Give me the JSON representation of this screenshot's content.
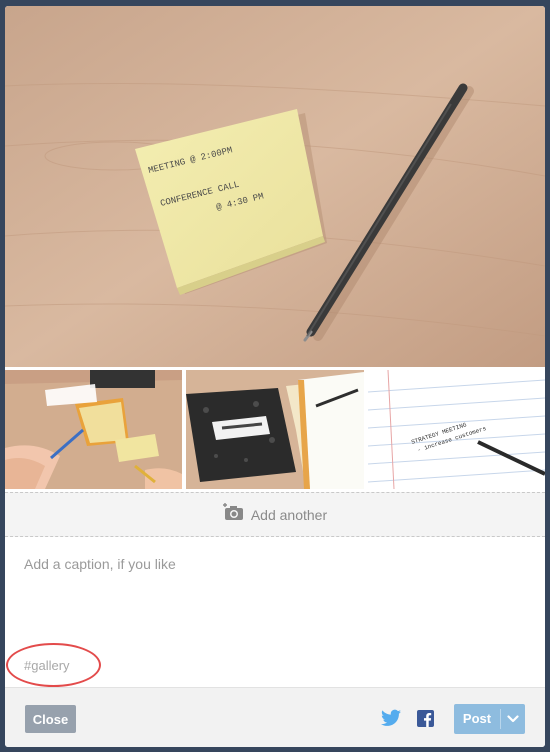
{
  "gallery": {
    "main_photo_alt": "Sticky note with a pen",
    "sticky_note_lines": [
      "MEETING @ 2:00PM",
      "CONFERENCE CALL",
      "@ 4:30 PM"
    ],
    "thumbnails": [
      {
        "alt": "Hands writing on notepads at a table"
      },
      {
        "alt": "Composition notebook with pen"
      },
      {
        "alt": "Notebook page with handwritten note"
      }
    ],
    "thumbnail_note_lines": [
      "STRATEGY MEETING",
      "- increase customers"
    ]
  },
  "add_another": {
    "label": "Add another",
    "icon": "camera-plus-icon"
  },
  "caption": {
    "placeholder": "Add a caption, if you like",
    "value": ""
  },
  "tags": {
    "placeholder": "#gallery",
    "value": ""
  },
  "annotation": {
    "color": "#e34b4b"
  },
  "footer": {
    "close_label": "Close",
    "twitter_icon": "twitter-icon",
    "facebook_icon": "facebook-icon",
    "post_label": "Post",
    "post_menu_icon": "chevron-down-icon"
  },
  "colors": {
    "backdrop": "#36465d",
    "close_button": "#97a1ad",
    "post_button": "#8ebcdf",
    "twitter": "#55acee",
    "facebook": "#3b5998"
  }
}
